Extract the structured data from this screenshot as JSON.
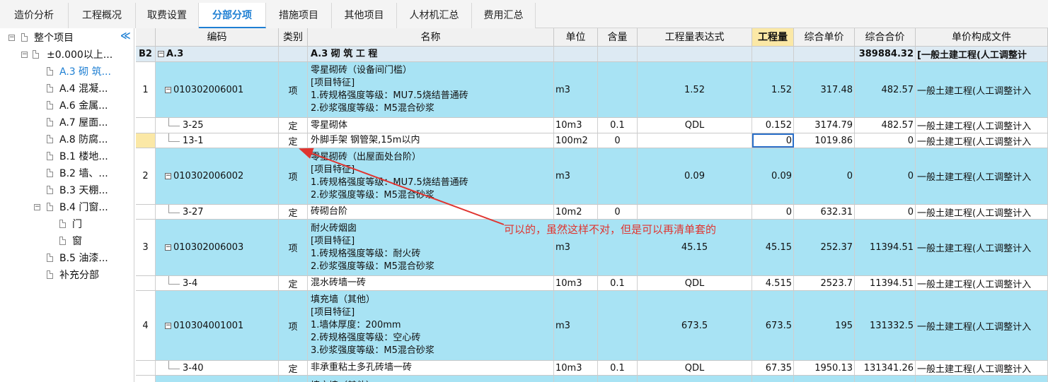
{
  "tabs": [
    {
      "label": "造价分析",
      "active": false
    },
    {
      "label": "工程概况",
      "active": false
    },
    {
      "label": "取费设置",
      "active": false
    },
    {
      "label": "分部分项",
      "active": true
    },
    {
      "label": "措施项目",
      "active": false
    },
    {
      "label": "其他项目",
      "active": false
    },
    {
      "label": "人材机汇总",
      "active": false
    },
    {
      "label": "费用汇总",
      "active": false
    }
  ],
  "tree": {
    "collapse_glyph": "≪",
    "items": [
      {
        "label": "整个项目",
        "selected": false
      },
      {
        "label": "±0.000以上...",
        "selected": false
      },
      {
        "label": "A.3 砌 筑...",
        "selected": true
      },
      {
        "label": "A.4 混凝...",
        "selected": false
      },
      {
        "label": "A.6 金属...",
        "selected": false
      },
      {
        "label": "A.7 屋面...",
        "selected": false
      },
      {
        "label": "A.8 防腐...",
        "selected": false
      },
      {
        "label": "B.1 楼地...",
        "selected": false
      },
      {
        "label": "B.2 墙、...",
        "selected": false
      },
      {
        "label": "B.3 天棚...",
        "selected": false
      },
      {
        "label": "B.4 门窗...",
        "selected": false
      },
      {
        "label": "门",
        "selected": false
      },
      {
        "label": "窗",
        "selected": false
      },
      {
        "label": "B.5 油漆...",
        "selected": false
      },
      {
        "label": "补充分部",
        "selected": false
      }
    ]
  },
  "columns": [
    "",
    "编码",
    "类别",
    "名称",
    "单位",
    "含量",
    "工程量表达式",
    "工程量",
    "综合单价",
    "综合合价",
    "单价构成文件"
  ],
  "rows": [
    {
      "kind": "b2",
      "num": "B2",
      "code": "A.3",
      "type": "",
      "name": [
        "A.3   砌  筑  工  程"
      ],
      "unit": "",
      "content": "",
      "expr": "",
      "qty": "",
      "price": "",
      "total": "389884.32",
      "file": "[一般土建工程(人工调整计"
    },
    {
      "kind": "item",
      "num": "1",
      "code": "010302006001",
      "type": "项",
      "name": [
        "零星砌砖（设备间门槛）",
        "[项目特征]",
        "1.砖规格强度等级：MU7.5烧结普通砖",
        "2.砂浆强度等级：M5混合砂浆"
      ],
      "unit": "m3",
      "content": "",
      "expr": "1.52",
      "qty": "1.52",
      "price": "317.48",
      "total": "482.57",
      "file": "一般土建工程(人工调整计入"
    },
    {
      "kind": "quota",
      "num": "",
      "code": "3-25",
      "type": "定",
      "name": [
        "零星砌体"
      ],
      "unit": "10m3",
      "content": "0.1",
      "expr": "QDL",
      "qty": "0.152",
      "price": "3174.79",
      "total": "482.57",
      "file": "一般土建工程(人工调整计入"
    },
    {
      "kind": "quota",
      "num": "",
      "code": "13-1",
      "type": "定",
      "name": [
        "外脚手架 钢管架,15m以内"
      ],
      "unit": "100m2",
      "content": "0",
      "expr": "",
      "qty": "0",
      "price": "1019.86",
      "total": "0",
      "file": "一般土建工程(人工调整计入"
    },
    {
      "kind": "item",
      "num": "2",
      "code": "010302006002",
      "type": "项",
      "name": [
        "零星砌砖（出屋面处台阶）",
        "[项目特征]",
        "1.砖规格强度等级：MU7.5烧结普通砖",
        "2.砂浆强度等级：M5混合砂浆"
      ],
      "unit": "m3",
      "content": "",
      "expr": "0.09",
      "qty": "0.09",
      "price": "0",
      "total": "0",
      "file": "一般土建工程(人工调整计入"
    },
    {
      "kind": "quota",
      "num": "",
      "code": "3-27",
      "type": "定",
      "name": [
        "砖砌台阶"
      ],
      "unit": "10m2",
      "content": "0",
      "expr": "",
      "qty": "0",
      "price": "632.31",
      "total": "0",
      "file": "一般土建工程(人工调整计入"
    },
    {
      "kind": "item",
      "num": "3",
      "code": "010302006003",
      "type": "项",
      "name": [
        "耐火砖烟囱",
        "[项目特征]",
        "1.砖规格强度等级：耐火砖",
        "2.砂浆强度等级：M5混合砂浆"
      ],
      "unit": "m3",
      "content": "",
      "expr": "45.15",
      "qty": "45.15",
      "price": "252.37",
      "total": "11394.51",
      "file": "一般土建工程(人工调整计入"
    },
    {
      "kind": "quota",
      "num": "",
      "code": "3-4",
      "type": "定",
      "name": [
        "混水砖墙一砖"
      ],
      "unit": "10m3",
      "content": "0.1",
      "expr": "QDL",
      "qty": "4.515",
      "price": "2523.7",
      "total": "11394.51",
      "file": "一般土建工程(人工调整计入"
    },
    {
      "kind": "item",
      "num": "4",
      "code": "010304001001",
      "type": "项",
      "name": [
        "填充墙（其他）",
        "[项目特征]",
        "1.墙体厚度：200mm",
        "2.砖规格强度等级：空心砖",
        "3.砂浆强度等级：M5混合砂浆"
      ],
      "unit": "m3",
      "content": "",
      "expr": "673.5",
      "qty": "673.5",
      "price": "195",
      "total": "131332.5",
      "file": "一般土建工程(人工调整计入"
    },
    {
      "kind": "quota",
      "num": "",
      "code": "3-40",
      "type": "定",
      "name": [
        "非承重粘土多孔砖墙一砖"
      ],
      "unit": "10m3",
      "content": "0.1",
      "expr": "QDL",
      "qty": "67.35",
      "price": "1950.13",
      "total": "131341.26",
      "file": "一般土建工程(人工调整计入"
    },
    {
      "kind": "item",
      "num": "",
      "code": "",
      "type": "",
      "name": [
        "填充墙（其他）"
      ],
      "unit": "",
      "content": "",
      "expr": "",
      "qty": "",
      "price": "",
      "total": "",
      "file": ""
    }
  ],
  "annotation": {
    "text": "可以的，虽然这样不对，但是可以再清单套的",
    "color": "#e0342f"
  },
  "colors": {
    "accent": "#1e7fd3",
    "item_row": "#a8e3f4",
    "highlight_header": "#fbe8a6"
  }
}
